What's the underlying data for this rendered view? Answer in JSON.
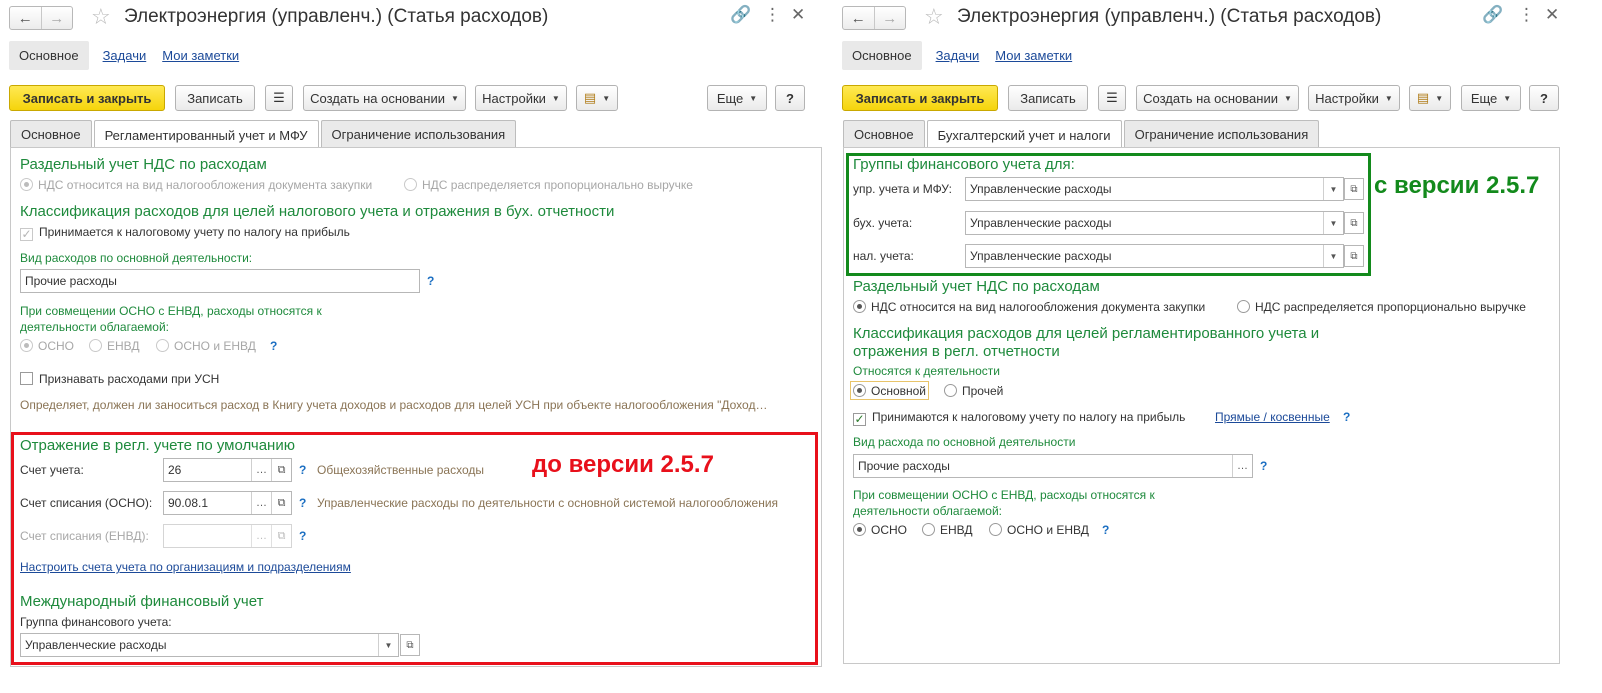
{
  "left": {
    "nav": {
      "back": "←",
      "fwd": "→"
    },
    "title": "Электроэнергия (управленч.) (Статья расходов)",
    "section_nav": [
      "Основное",
      "Задачи",
      "Мои заметки"
    ],
    "toolbar": {
      "save_close": "Записать и закрыть",
      "save": "Записать",
      "create_based": "Создать на основании",
      "settings": "Настройки",
      "more": "Еще",
      "help": "?"
    },
    "tabs": [
      "Основное",
      "Регламентированный учет и МФУ",
      "Ограничение использования"
    ],
    "vat": {
      "header": "Раздельный учет НДС по расходам",
      "opt1": "НДС относится на вид налогообложения документа закупки",
      "opt2": "НДС распределяется пропорционально выручке"
    },
    "classif": {
      "header": "Классификация расходов для целей налогового учета и отражения в бух. отчетности",
      "profit_tax": "Принимается к налоговому учету по налогу на прибыль",
      "kind_label": "Вид расходов по основной деятельности:",
      "kind_value": "Прочие расходы",
      "envd_label_1": "При совмещении ОСНО с ЕНВД, расходы относятся к",
      "envd_label_2": "деятельности облагаемой:",
      "osno": "ОСНО",
      "envd": "ЕНВД",
      "osno_envd": "ОСНО и ЕНВД",
      "usn_check": "Признавать расходами при УСН",
      "usn_desc": "Определяет, должен ли заноситься расход в Книгу учета доходов и расходов для целей УСН при объекте налогообложения \"Доход…"
    },
    "reg": {
      "header": "Отражение в регл. учете по умолчанию",
      "account_label": "Счет учета:",
      "account_value": "26",
      "account_desc": "Общехозяйственные расходы",
      "writeoff_label": "Счет списания (ОСНО):",
      "writeoff_value": "90.08.1",
      "writeoff_desc": "Управленческие расходы по деятельности с основной системой налогообложения",
      "writeoff_envd_label": "Счет списания (ЕНВД):",
      "writeoff_envd_value": "",
      "setup_link": "Настроить счета учета по организациям и подразделениям",
      "ifu_header": "Международный финансовый учет",
      "ifu_group_label": "Группа финансового учета:",
      "ifu_group_value": "Управленческие расходы"
    },
    "version_note": "до версии 2.5.7"
  },
  "right": {
    "nav": {
      "back": "←",
      "fwd": "→"
    },
    "title": "Электроэнергия (управленч.) (Статья расходов)",
    "section_nav": [
      "Основное",
      "Задачи",
      "Мои заметки"
    ],
    "toolbar": {
      "save_close": "Записать и закрыть",
      "save": "Записать",
      "create_based": "Создать на основании",
      "settings": "Настройки",
      "more": "Еще",
      "help": "?"
    },
    "tabs": [
      "Основное",
      "Бухгалтерский учет и налоги",
      "Ограничение использования"
    ],
    "groups": {
      "header": "Группы финансового учета для:",
      "mgmt_label": "упр. учета и МФУ:",
      "mgmt_value": "Управленческие расходы",
      "acc_label": "бух. учета:",
      "acc_value": "Управленческие расходы",
      "tax_label": "нал. учета:",
      "tax_value": "Управленческие расходы"
    },
    "version_note": "с версии 2.5.7",
    "vat": {
      "header": "Раздельный учет НДС по расходам",
      "opt1": "НДС относится на вид налогообложения документа закупки",
      "opt2": "НДС распределяется пропорционально выручке"
    },
    "classif": {
      "header_1": "Классификация расходов для целей регламентированного учета и",
      "header_2": "отражения в регл. отчетности",
      "activity_label": "Относятся к деятельности",
      "main": "Основной",
      "other": "Прочей",
      "profit_tax": "Принимаются к налоговому учету по налогу на прибыль",
      "direct_indirect": "Прямые / косвенные",
      "kind_label": "Вид расхода по основной деятельности",
      "kind_value": "Прочие расходы",
      "envd_label_1": "При совмещении ОСНО с ЕНВД, расходы относятся к",
      "envd_label_2": "деятельности облагаемой:",
      "osno": "ОСНО",
      "envd": "ЕНВД",
      "osno_envd": "ОСНО и ЕНВД"
    }
  },
  "colors": {
    "accent_green": "#1e8a3c",
    "red_note": "#e8101b",
    "green_note": "#138a1c",
    "primary_button": "#f5d40b"
  }
}
